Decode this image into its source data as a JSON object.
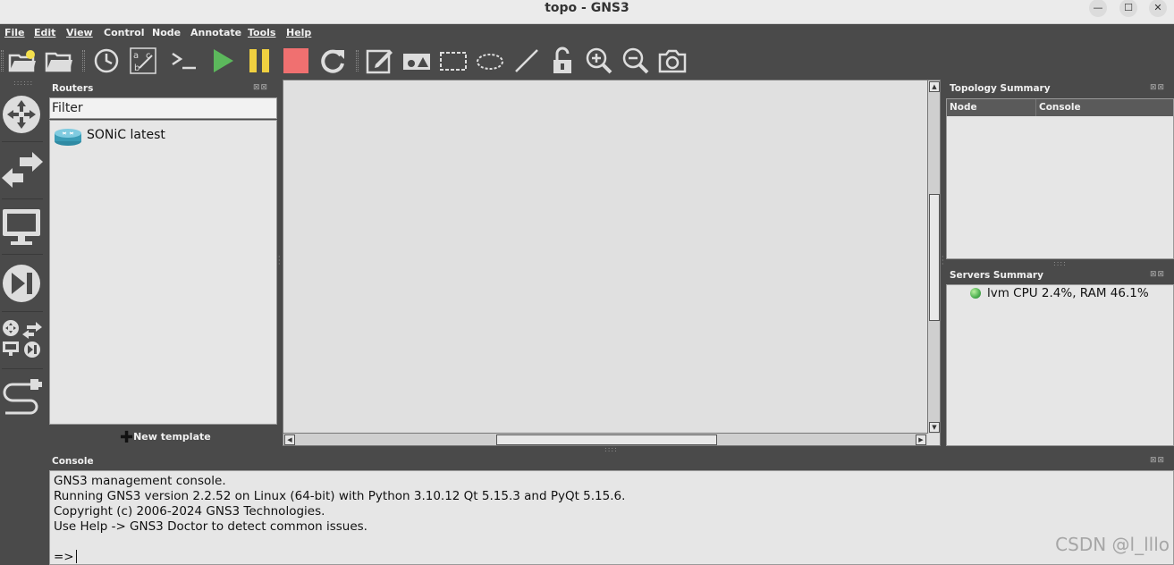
{
  "window": {
    "title": "topo - GNS3"
  },
  "menu": [
    "File",
    "Edit",
    "View",
    "Control",
    "Node",
    "Annotate",
    "Tools",
    "Help"
  ],
  "routers_dock": {
    "title": "Routers",
    "filter_text": "Filter",
    "items": [
      {
        "label": "SONiC latest",
        "icon": "router-icon"
      }
    ],
    "new_template_label": "New template"
  },
  "topology_summary": {
    "title": "Topology Summary",
    "columns": [
      "Node",
      "Console"
    ]
  },
  "servers_summary": {
    "title": "Servers Summary",
    "servers": [
      {
        "text": "lvm CPU 2.4%, RAM 46.1%",
        "status_color": "#4caf50"
      }
    ]
  },
  "console": {
    "title": "Console",
    "lines": [
      "GNS3 management console.",
      "Running GNS3 version 2.2.52 on Linux (64-bit) with Python 3.10.12 Qt 5.15.3 and PyQt 5.15.6.",
      "Copyright (c) 2006-2024 GNS3 Technologies.",
      "Use Help -> GNS3 Doctor to detect common issues.",
      "",
      "=>"
    ]
  },
  "watermark": "CSDN @l_lllo",
  "colors": {
    "accent_play": "#5cb85c",
    "accent_pause": "#f0d040",
    "accent_stop": "#f07070",
    "chrome": "#4a4a4a"
  }
}
